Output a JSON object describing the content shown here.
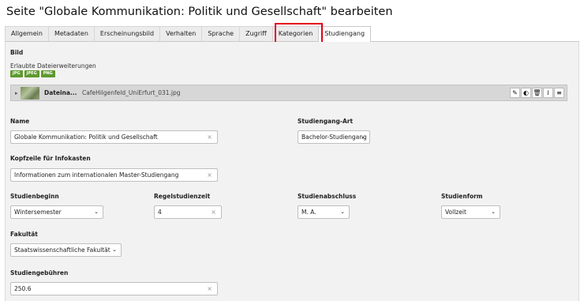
{
  "page_title": "Seite \"Globale Kommunikation: Politik und Gesellschaft\" bearbeiten",
  "tabs": [
    {
      "label": "Allgemein"
    },
    {
      "label": "Metadaten"
    },
    {
      "label": "Erscheinungsbild"
    },
    {
      "label": "Verhalten"
    },
    {
      "label": "Sprache"
    },
    {
      "label": "Zugriff"
    },
    {
      "label": "Kategorien"
    },
    {
      "label": "Studiengang"
    }
  ],
  "bild": {
    "section_label": "Bild",
    "extensions_label": "Erlaubte Dateierweiterungen",
    "extensions": [
      "JPG",
      "JPEG",
      "PNG"
    ],
    "file": {
      "name": "Dateina...",
      "original": "CafeHilgenfeld_UniErfurt_031.jpg"
    }
  },
  "fields": {
    "name": {
      "label": "Name",
      "value": "Globale Kommunikation: Politik und Gesellschaft"
    },
    "studiengang_art": {
      "label": "Studiengang-Art",
      "value": "Bachelor-Studiengang"
    },
    "kopfzeile": {
      "label": "Kopfzeile für Infokasten",
      "value": "Informationen zum internationalen Master-Studiengang"
    },
    "studienbeginn": {
      "label": "Studienbeginn",
      "value": "Wintersemester"
    },
    "regelstudienzeit": {
      "label": "Regelstudienzeit",
      "value": "4"
    },
    "studienabschluss": {
      "label": "Studienabschluss",
      "value": "M. A."
    },
    "studienform": {
      "label": "Studienform",
      "value": "Vollzeit"
    },
    "fakultaet": {
      "label": "Fakultät",
      "value": "Staatswissenschaftliche Fakultät"
    },
    "studiengebuehren": {
      "label": "Studiengebühren",
      "value": "250.6"
    }
  },
  "icons": {
    "edit": "pencil-icon",
    "toggle": "toggle-icon",
    "delete": "trash-icon",
    "info": "info-icon",
    "drag": "drag-handle-icon",
    "clear": "clear-x-icon",
    "caret": "chevron-down-icon"
  },
  "colors": {
    "badge": "#5e9a2e",
    "highlight": "#e2001a"
  }
}
